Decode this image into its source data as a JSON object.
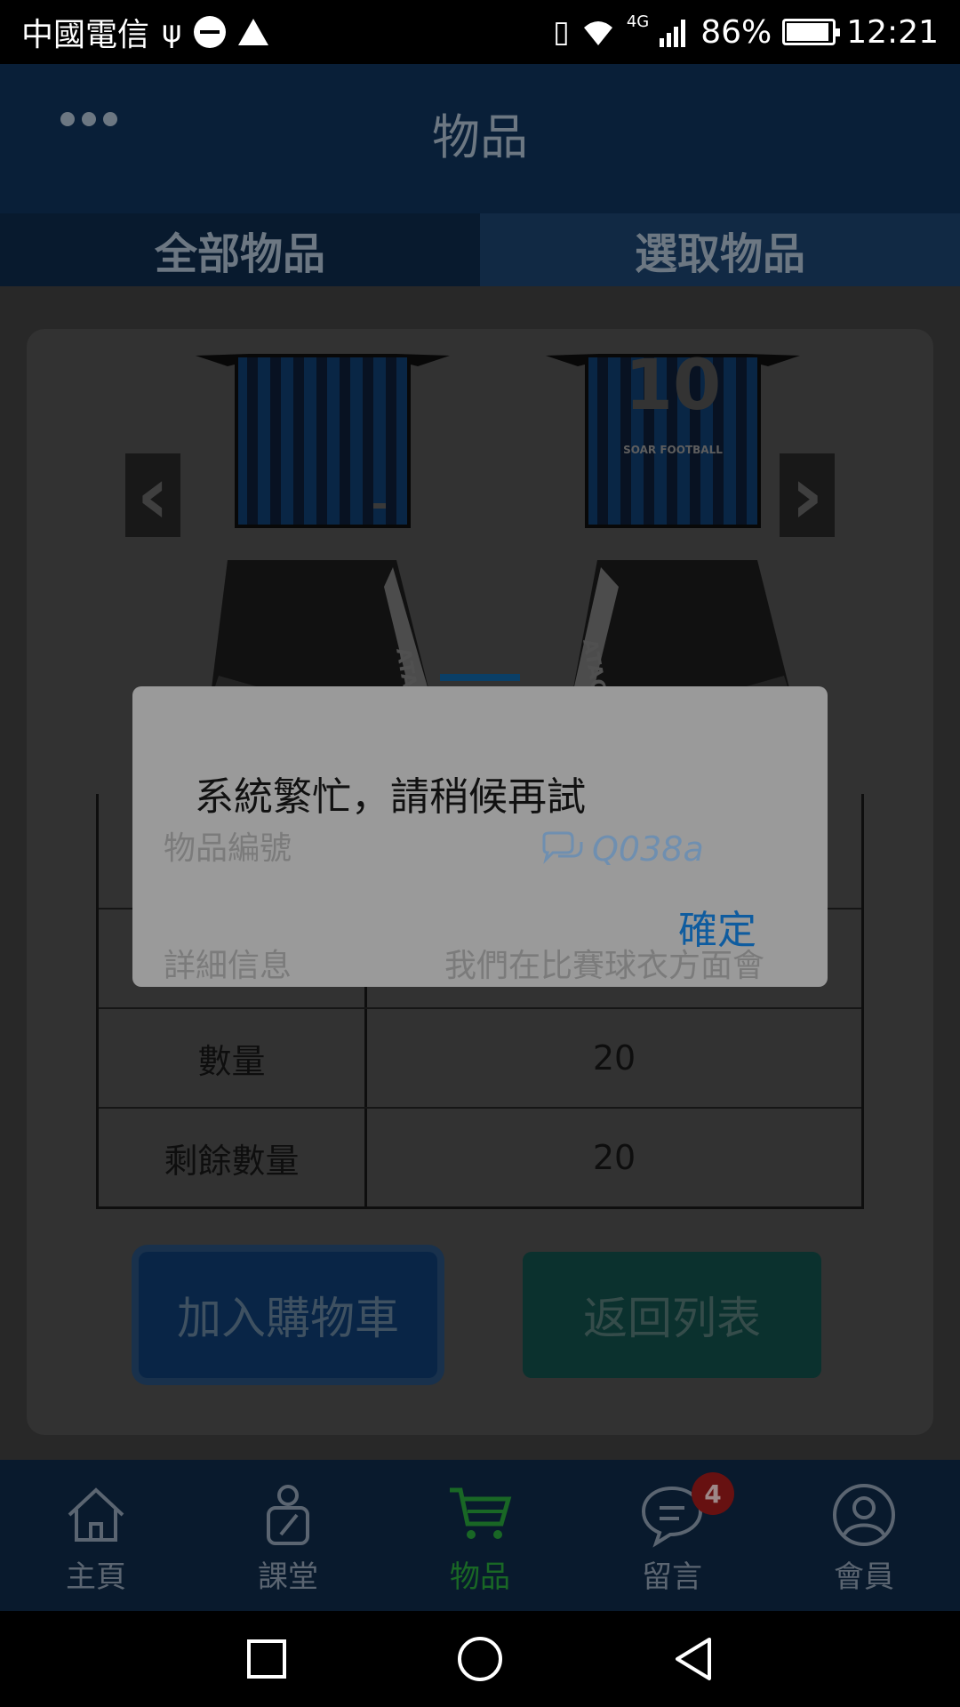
{
  "status_bar": {
    "carrier": "中國電信",
    "signal_label": "4G",
    "battery": "86%",
    "time": "12:21"
  },
  "header": {
    "title": "物品",
    "tabs": [
      {
        "label": "全部物品"
      },
      {
        "label": "選取物品"
      }
    ]
  },
  "kits": {
    "left_shirt": "",
    "right_shirt_number": "10",
    "right_shirt_text": "SOAR FOOTBALL",
    "shorts_text_left": "ATAGAR",
    "shorts_text_right": "ATAGAR"
  },
  "item_table": {
    "rows": [
      {
        "key": "物品編號",
        "value": "Q038a"
      },
      {
        "key": "詳細信息",
        "value": "我們在比賽球衣方面會"
      },
      {
        "key": "數量",
        "value": "20"
      },
      {
        "key": "剩餘數量",
        "value": "20"
      }
    ]
  },
  "buttons": {
    "add_to_cart": "加入購物車",
    "back_to_list": "返回列表"
  },
  "bottom_nav": {
    "items": [
      {
        "label": "主頁",
        "icon": "home-icon"
      },
      {
        "label": "課堂",
        "icon": "classroom-icon"
      },
      {
        "label": "物品",
        "icon": "cart-icon"
      },
      {
        "label": "留言",
        "icon": "message-icon"
      },
      {
        "label": "會員",
        "icon": "member-icon"
      }
    ],
    "message_badge": "4"
  },
  "dialog": {
    "message": "系統繁忙，請稍候再試",
    "confirm_label": "確定"
  },
  "colors": {
    "header_bg": "#0b2542",
    "active_nav": "#1e7a2c",
    "confirm": "#0f5c9f",
    "dialog_bg": "#9a9a9a"
  }
}
